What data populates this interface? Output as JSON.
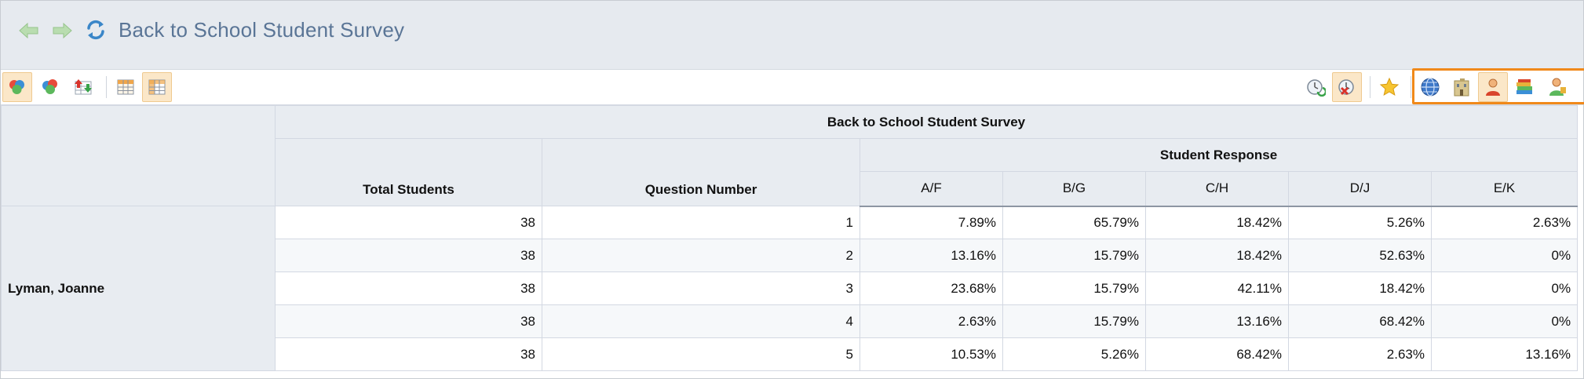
{
  "header": {
    "title": "Back to School Student Survey",
    "back_icon": "arrow-left-icon",
    "forward_icon": "arrow-right-icon",
    "refresh_icon": "refresh-icon"
  },
  "colors": {
    "title_text": "#5a7596",
    "highlight_border": "#f0891a",
    "active_button_bg": "#fbe7c8",
    "header_bg": "#e8ecf1"
  },
  "toolbar": {
    "left_buttons": [
      {
        "icon": "circles-group-icon",
        "active": true
      },
      {
        "icon": "circles-group-alt-icon",
        "active": false
      },
      {
        "icon": "export-arrows-icon",
        "active": false
      },
      {
        "icon": "grid-table-icon",
        "active": false
      },
      {
        "icon": "grid-table-highlight-icon",
        "active": true
      }
    ],
    "right_buttons": [
      {
        "icon": "clock-refresh-icon",
        "active": false
      },
      {
        "icon": "clock-cancel-icon",
        "active": true
      },
      {
        "icon": "star-icon",
        "active": false
      },
      {
        "icon": "globe-icon",
        "active": false
      },
      {
        "icon": "school-building-icon",
        "active": false
      },
      {
        "icon": "person-icon",
        "active": true
      },
      {
        "icon": "books-icon",
        "active": false
      },
      {
        "icon": "teacher-icon",
        "active": false
      }
    ]
  },
  "table": {
    "title": "Back to School Student Survey",
    "columns": {
      "total_students": "Total Students",
      "question_number": "Question Number",
      "student_response": "Student Response",
      "responses": [
        "A/F",
        "B/G",
        "C/H",
        "D/J",
        "E/K"
      ]
    },
    "row_group_label": "Lyman, Joanne",
    "rows": [
      {
        "total": "38",
        "question": "1",
        "values": [
          "7.89%",
          "65.79%",
          "18.42%",
          "5.26%",
          "2.63%"
        ]
      },
      {
        "total": "38",
        "question": "2",
        "values": [
          "13.16%",
          "15.79%",
          "18.42%",
          "52.63%",
          "0%"
        ]
      },
      {
        "total": "38",
        "question": "3",
        "values": [
          "23.68%",
          "15.79%",
          "42.11%",
          "18.42%",
          "0%"
        ]
      },
      {
        "total": "38",
        "question": "4",
        "values": [
          "2.63%",
          "15.79%",
          "13.16%",
          "68.42%",
          "0%"
        ]
      },
      {
        "total": "38",
        "question": "5",
        "values": [
          "10.53%",
          "5.26%",
          "68.42%",
          "2.63%",
          "13.16%"
        ]
      }
    ]
  }
}
